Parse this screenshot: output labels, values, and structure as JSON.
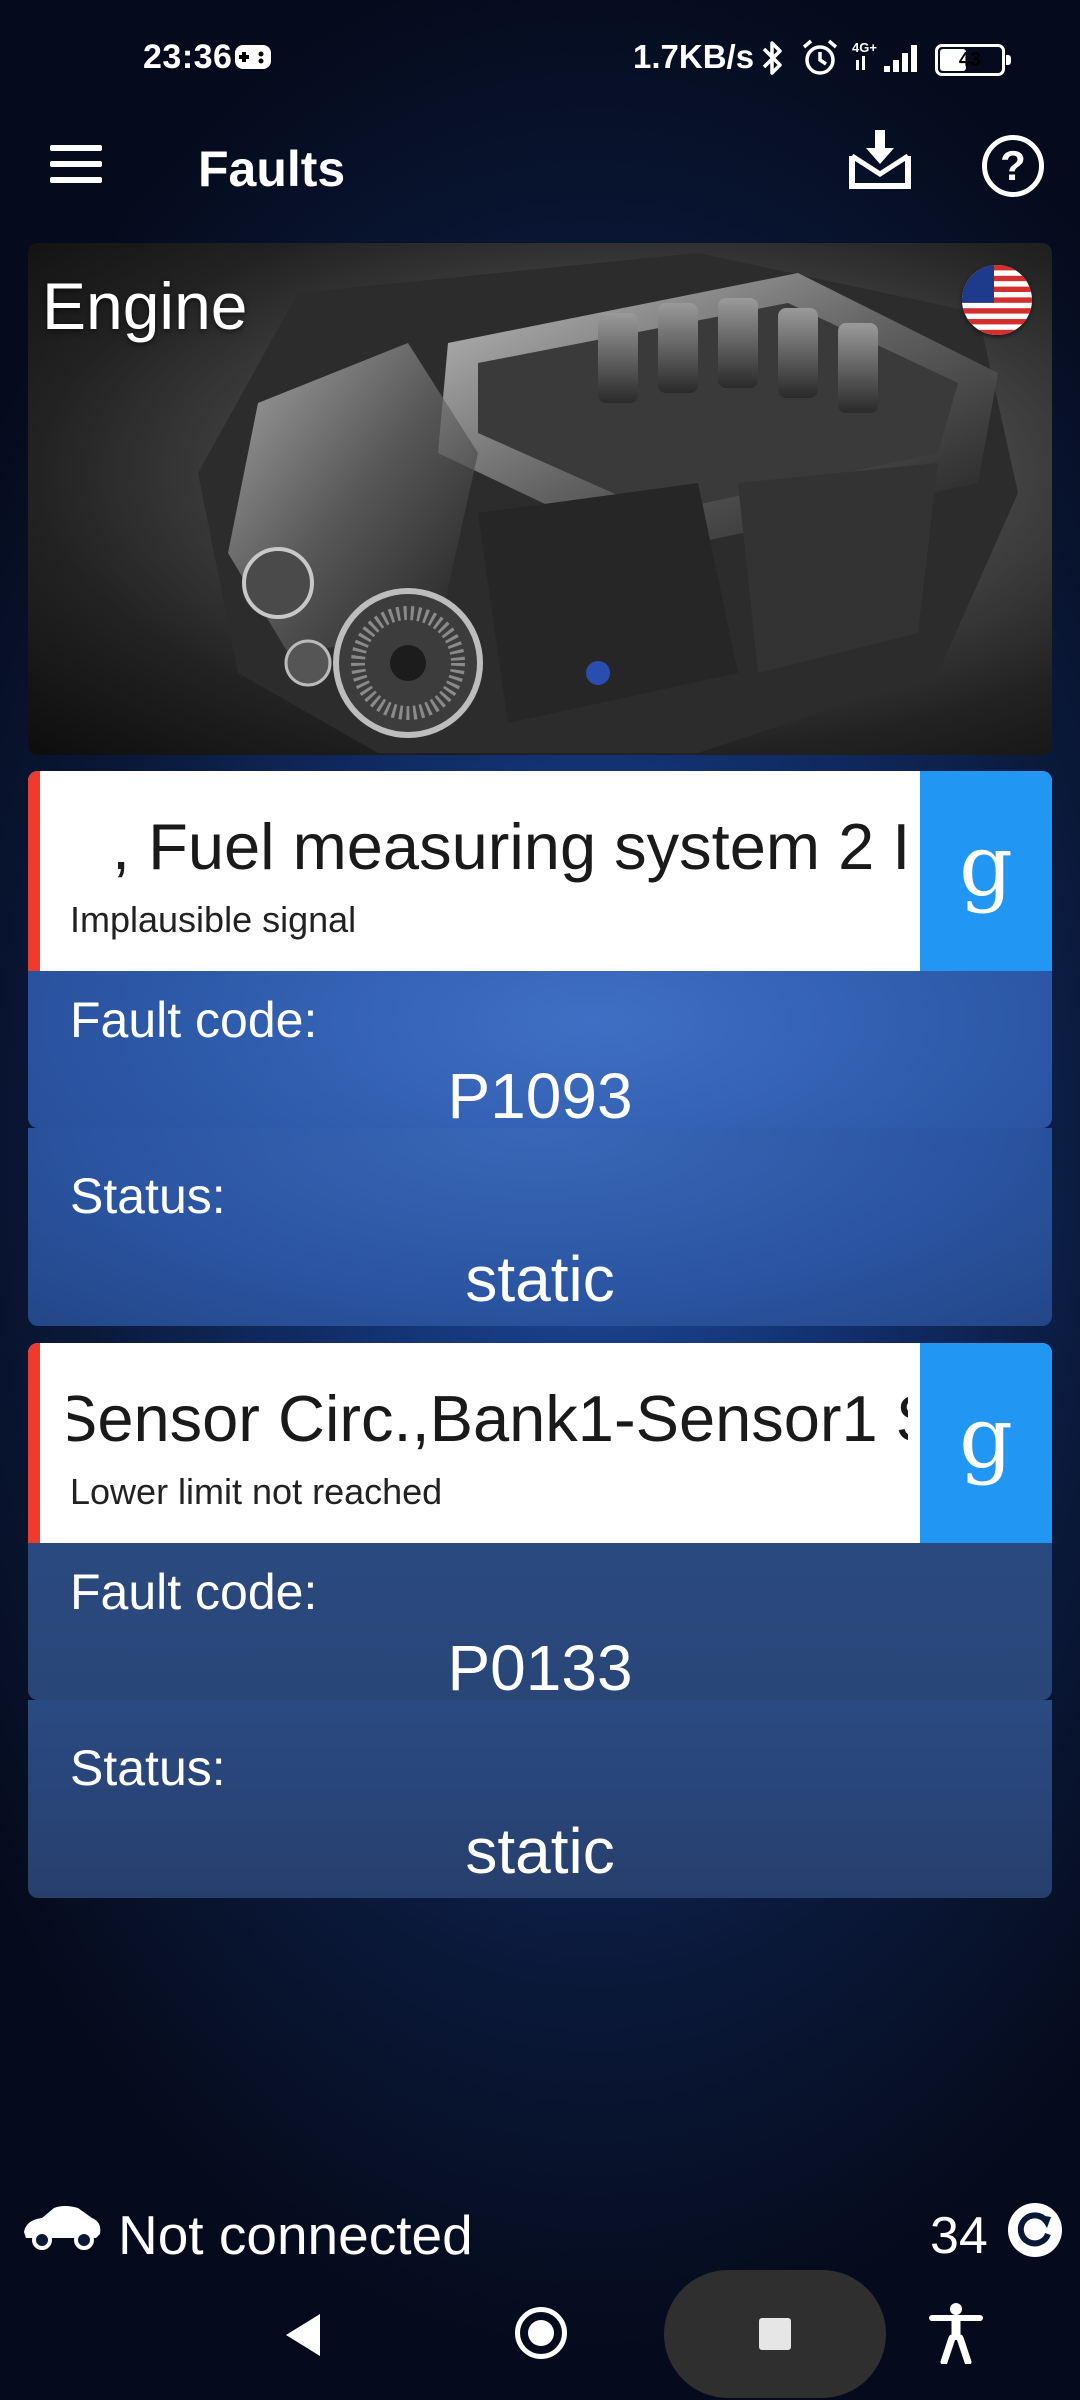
{
  "status_bar": {
    "time": "23:36",
    "net_speed": "1.7KB/s",
    "network_type": "4G+",
    "battery": "43",
    "icons": [
      "game-controller-icon",
      "bluetooth-icon",
      "alarm-icon",
      "signal-icon",
      "battery-icon"
    ]
  },
  "app_bar": {
    "title": "Faults",
    "icons": [
      "menu-icon",
      "download-icon",
      "help-icon"
    ],
    "help_glyph": "?"
  },
  "engine_card": {
    "title": "Engine",
    "flag": "us-flag-icon"
  },
  "faults": [
    {
      "name": ", Fuel measuring system 2 I",
      "description": "Implausible signal",
      "code_label": "Fault code:",
      "code": "P1093",
      "status_label": "Status:",
      "status": "static",
      "search_glyph": "g"
    },
    {
      "name": "Sensor Circ.,Bank1-Sensor1 S",
      "description": "Lower limit not reached",
      "code_label": "Fault code:",
      "code": "P0133",
      "status_label": "Status:",
      "status": "static",
      "search_glyph": "g"
    }
  ],
  "footer": {
    "connection": "Not connected",
    "counter": "34"
  },
  "colors": {
    "accent_blue": "#2196f3",
    "fault_red": "#f03a2e",
    "card_header": "#ffffff"
  }
}
